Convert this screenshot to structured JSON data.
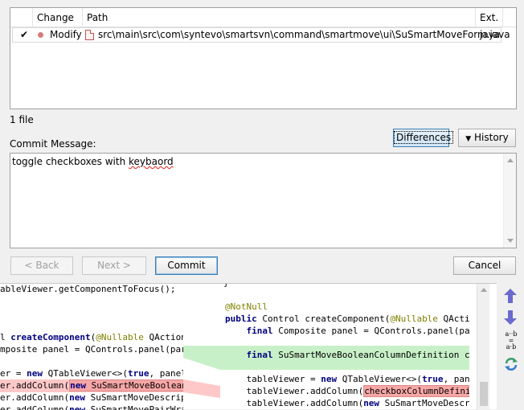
{
  "table": {
    "headers": {
      "change": "Change",
      "path": "Path",
      "ext": "Ext."
    },
    "rows": [
      {
        "checked": true,
        "change": "Modify",
        "path": "src\\main\\src\\com\\syntevo\\smartsvn\\command\\smartmove\\ui\\SuSmartMoveForm.java",
        "ext": "java"
      }
    ]
  },
  "file_count": "1 file",
  "commit": {
    "label": "Commit Message:",
    "text_plain": "toggle checkboxes with ",
    "text_misspelled": "keybaord"
  },
  "buttons": {
    "differences": "Differences",
    "history": "History",
    "back": "< Back",
    "next": "Next >",
    "commit": "Commit",
    "cancel": "Cancel"
  },
  "diff": {
    "left_lines": [
      "ableViewer.getComponentToFocus();",
      "",
      "",
      "",
      "l createComponent(@Nullable QAction bo",
      "mposite panel = QControls.panel(parent",
      "",
      "er = new QTableViewer<>(true, panel);",
      "er.addColumn(new SuSmartMoveBooleanCol",
      "er.addColumn(new SuSmartMoveDescripti",
      "er.addColumn(new SuSmartMovePairWrappi"
    ],
    "right_lines": [
      "}",
      "",
      "@NotNull",
      "public Control createComponent(@Nullable QAction bo",
      "    final Composite panel = QControls.panel(parent);",
      "",
      "    final SuSmartMoveBooleanColumnDefinition checkb",
      "",
      "    tableViewer = new QTableViewer<>(true, panel);",
      "    tableViewer.addColumn(checkboxColumnDefinition);",
      "    tableViewer.addColumn(new SuSmartMoveDescripti"
    ]
  },
  "toolbar": {
    "compare_label_top": "a··b",
    "compare_label_eq": "=",
    "compare_label_bottom": "a·b"
  }
}
